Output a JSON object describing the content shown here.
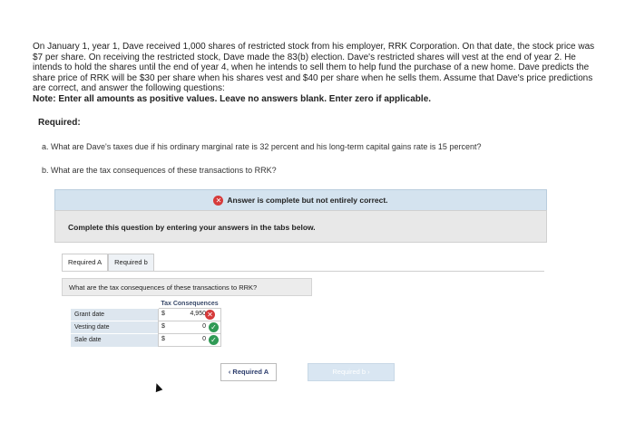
{
  "problem": {
    "text": "On January 1, year 1, Dave received 1,000 shares of restricted stock from his employer, RRK Corporation. On that date, the stock price was $7 per share. On receiving the restricted stock, Dave made the 83(b) election. Dave's restricted shares will vest at the end of year 2. He intends to hold the shares until the end of year 4, when he intends to sell them to help fund the purchase of a new home. Dave predicts the share price of RRK will be $30 per share when his shares vest and $40 per share when he sells them. Assume that Dave's price predictions are correct, and answer the following questions:",
    "note": "Note: Enter all amounts as positive values. Leave no answers blank. Enter zero if applicable."
  },
  "required": {
    "heading": "Required:",
    "a": "a. What are Dave's taxes due if his ordinary marginal rate is 32 percent and his long-term capital gains rate is 15 percent?",
    "b": "b. What are the tax consequences of these transactions to RRK?"
  },
  "answer_bar": {
    "text": "Answer is complete but not entirely correct.",
    "status_color": "#d63b3b"
  },
  "instructions": "Complete this question by entering your answers in the tabs below.",
  "tabs": [
    {
      "label": "Required A"
    },
    {
      "label": "Required b"
    }
  ],
  "panel": {
    "question": "What are the tax consequences of these transactions to RRK?",
    "column_header": "Tax Consequences",
    "rows": [
      {
        "label": "Grant date",
        "currency": "$",
        "value": "4,950",
        "status": "incorrect"
      },
      {
        "label": "Vesting date",
        "currency": "$",
        "value": "0",
        "status": "correct"
      },
      {
        "label": "Sale date",
        "currency": "$",
        "value": "0",
        "status": "correct"
      }
    ]
  },
  "nav": {
    "prev_label": "‹  Required A",
    "next_label": "Required b  ›"
  },
  "colors": {
    "incorrect": "#d63b3b",
    "correct": "#2f9a55",
    "accent": "#d4e3ef"
  }
}
